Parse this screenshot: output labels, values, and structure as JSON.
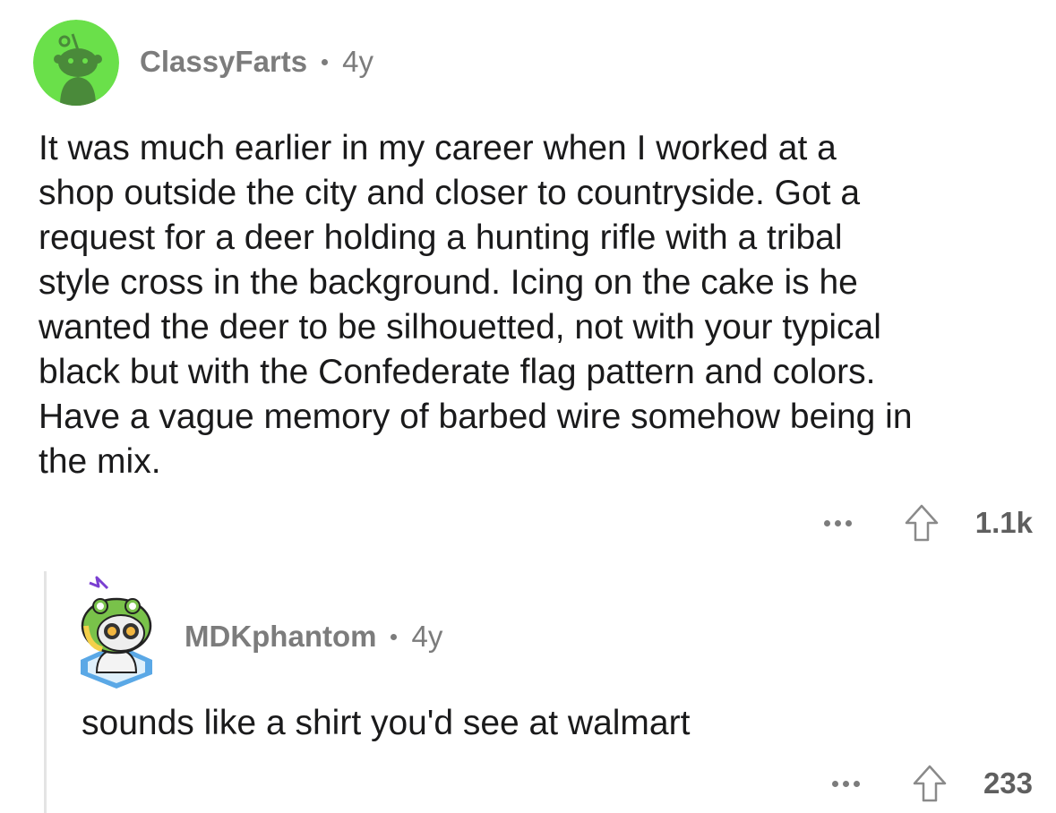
{
  "comment": {
    "author": "ClassyFarts",
    "age": "4y",
    "body": "It was much earlier in my career when I worked at a\nshop outside the city and closer to countryside. Got a\nrequest for a deer holding a hunting rifle with a tribal\nstyle cross in the background. Icing on the cake is he\nwanted the deer to be silhouetted, not with your typical\nblack but with the Confederate flag pattern and colors.\nHave a vague memory of barbed wire somehow being in\nthe mix.",
    "score": "1.1k",
    "avatar_color": "#6ae04a"
  },
  "reply": {
    "author": "MDKphantom",
    "age": "4y",
    "body": "sounds like a shirt you'd see at walmart",
    "score": "233"
  },
  "icons": {
    "more": "more-options-icon",
    "upvote": "upvote-arrow-icon"
  }
}
